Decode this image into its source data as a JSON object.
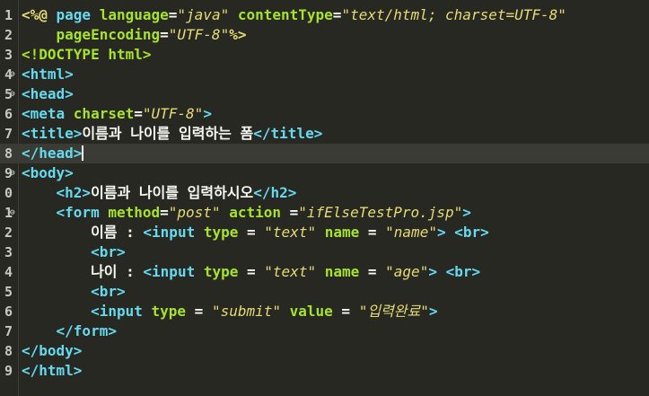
{
  "lines": [
    {
      "num": "1",
      "fold": "",
      "current": false,
      "tokens": [
        {
          "t": "<%@ ",
          "c": "dir"
        },
        {
          "t": "page ",
          "c": "jspkw"
        },
        {
          "t": "language",
          "c": "pk"
        },
        {
          "t": "=",
          "c": "txt"
        },
        {
          "t": "\"java\"",
          "c": "val"
        },
        {
          "t": " contentType",
          "c": "pk"
        },
        {
          "t": "=",
          "c": "txt"
        },
        {
          "t": "\"text/html; charset=UTF-8\"",
          "c": "val"
        }
      ]
    },
    {
      "num": "2",
      "fold": "",
      "current": false,
      "tokens": [
        {
          "t": "    pageEncoding",
          "c": "pk"
        },
        {
          "t": "=",
          "c": "txt"
        },
        {
          "t": "\"UTF-8\"",
          "c": "val"
        },
        {
          "t": "%>",
          "c": "dir"
        }
      ]
    },
    {
      "num": "3",
      "fold": "",
      "current": false,
      "tokens": [
        {
          "t": "<!DOCTYPE ",
          "c": "doctype"
        },
        {
          "t": "html",
          "c": "attr"
        },
        {
          "t": ">",
          "c": "doctype"
        }
      ]
    },
    {
      "num": "4",
      "fold": "⊖",
      "current": false,
      "tokens": [
        {
          "t": "<html>",
          "c": "tag"
        }
      ]
    },
    {
      "num": "5",
      "fold": "⊖",
      "current": false,
      "tokens": [
        {
          "t": "<head>",
          "c": "tag"
        }
      ]
    },
    {
      "num": "6",
      "fold": "",
      "current": false,
      "tokens": [
        {
          "t": "<meta ",
          "c": "tag"
        },
        {
          "t": "charset",
          "c": "attr"
        },
        {
          "t": "=",
          "c": "txt"
        },
        {
          "t": "\"UTF-8\"",
          "c": "val"
        },
        {
          "t": ">",
          "c": "tag"
        }
      ]
    },
    {
      "num": "7",
      "fold": "",
      "current": false,
      "tokens": [
        {
          "t": "<title>",
          "c": "tag"
        },
        {
          "t": "이름과 나이를 입력하는 폼",
          "c": "txt"
        },
        {
          "t": "</title>",
          "c": "tag"
        }
      ]
    },
    {
      "num": "8",
      "fold": "",
      "current": true,
      "caret": true,
      "tokens": [
        {
          "t": "</head>",
          "c": "tag"
        }
      ]
    },
    {
      "num": "9",
      "fold": "⊖",
      "current": false,
      "tokens": [
        {
          "t": "<body>",
          "c": "tag"
        }
      ]
    },
    {
      "num": "0",
      "fold": "",
      "current": false,
      "tokens": [
        {
          "t": "    ",
          "c": "txt"
        },
        {
          "t": "<h2>",
          "c": "tag"
        },
        {
          "t": "이름과 나이를 입력하시오",
          "c": "txt"
        },
        {
          "t": "</h2>",
          "c": "tag"
        }
      ]
    },
    {
      "num": "1",
      "fold": "⊖",
      "current": false,
      "tokens": [
        {
          "t": "    ",
          "c": "txt"
        },
        {
          "t": "<form ",
          "c": "tag"
        },
        {
          "t": "method",
          "c": "attr"
        },
        {
          "t": "=",
          "c": "txt"
        },
        {
          "t": "\"post\"",
          "c": "val"
        },
        {
          "t": " action ",
          "c": "attr"
        },
        {
          "t": "=",
          "c": "txt"
        },
        {
          "t": "\"ifElseTestPro.jsp\"",
          "c": "val"
        },
        {
          "t": ">",
          "c": "tag"
        }
      ]
    },
    {
      "num": "2",
      "fold": "",
      "current": false,
      "tokens": [
        {
          "t": "        이름 : ",
          "c": "txt"
        },
        {
          "t": "<input ",
          "c": "tag"
        },
        {
          "t": "type",
          "c": "attr"
        },
        {
          "t": " = ",
          "c": "txt"
        },
        {
          "t": "\"text\"",
          "c": "val"
        },
        {
          "t": " name",
          "c": "attr"
        },
        {
          "t": " = ",
          "c": "txt"
        },
        {
          "t": "\"name\"",
          "c": "val"
        },
        {
          "t": ">",
          "c": "tag"
        },
        {
          "t": " ",
          "c": "txt"
        },
        {
          "t": "<br>",
          "c": "tag"
        }
      ]
    },
    {
      "num": "3",
      "fold": "",
      "current": false,
      "tokens": [
        {
          "t": "        ",
          "c": "txt"
        },
        {
          "t": "<br>",
          "c": "tag"
        }
      ]
    },
    {
      "num": "4",
      "fold": "",
      "current": false,
      "tokens": [
        {
          "t": "        나이 : ",
          "c": "txt"
        },
        {
          "t": "<input ",
          "c": "tag"
        },
        {
          "t": "type",
          "c": "attr"
        },
        {
          "t": " = ",
          "c": "txt"
        },
        {
          "t": "\"text\"",
          "c": "val"
        },
        {
          "t": " name",
          "c": "attr"
        },
        {
          "t": " = ",
          "c": "txt"
        },
        {
          "t": "\"age\"",
          "c": "val"
        },
        {
          "t": ">",
          "c": "tag"
        },
        {
          "t": " ",
          "c": "txt"
        },
        {
          "t": "<br>",
          "c": "tag"
        }
      ]
    },
    {
      "num": "5",
      "fold": "",
      "current": false,
      "tokens": [
        {
          "t": "        ",
          "c": "txt"
        },
        {
          "t": "<br>",
          "c": "tag"
        }
      ]
    },
    {
      "num": "6",
      "fold": "",
      "current": false,
      "tokens": [
        {
          "t": "        ",
          "c": "txt"
        },
        {
          "t": "<input ",
          "c": "tag"
        },
        {
          "t": "type",
          "c": "attr"
        },
        {
          "t": " = ",
          "c": "txt"
        },
        {
          "t": "\"submit\"",
          "c": "val"
        },
        {
          "t": " value",
          "c": "attr"
        },
        {
          "t": " = ",
          "c": "txt"
        },
        {
          "t": "\"입력완료\"",
          "c": "val"
        },
        {
          "t": ">",
          "c": "tag"
        }
      ]
    },
    {
      "num": "7",
      "fold": "",
      "current": false,
      "tokens": [
        {
          "t": "    ",
          "c": "txt"
        },
        {
          "t": "</form>",
          "c": "tag"
        }
      ]
    },
    {
      "num": "8",
      "fold": "",
      "current": false,
      "tokens": [
        {
          "t": "</body>",
          "c": "tag"
        }
      ]
    },
    {
      "num": "9",
      "fold": "",
      "current": false,
      "tokens": [
        {
          "t": "</html>",
          "c": "tag"
        }
      ]
    }
  ],
  "colors": {
    "background": "#272822",
    "current_line": "#3a3b35",
    "tag": "#66d9ef",
    "attribute": "#a6e22e",
    "string": "#e6db74"
  }
}
